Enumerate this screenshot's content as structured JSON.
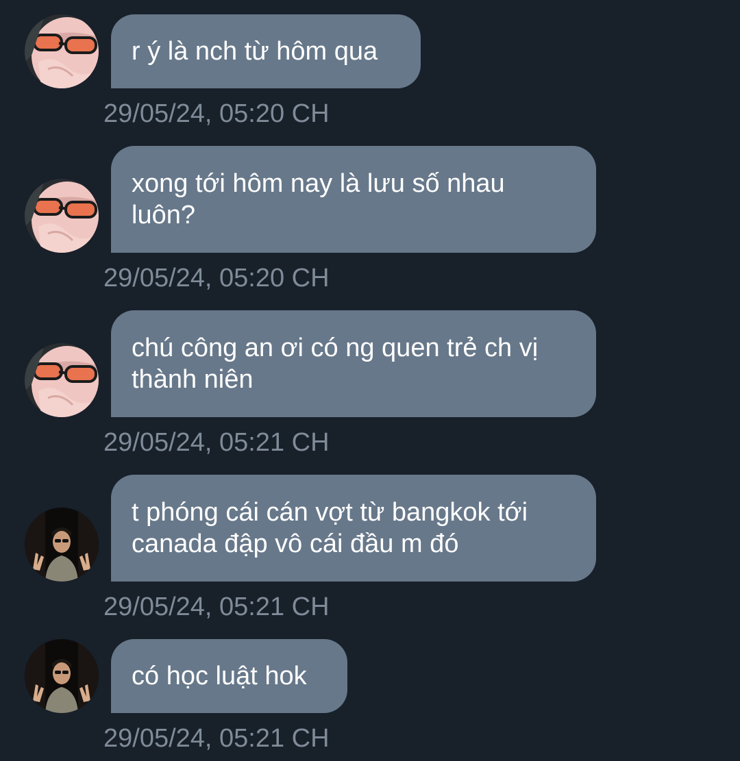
{
  "messages": [
    {
      "avatar": "sunglasses-avatar",
      "text": "r ý là nch từ hôm qua",
      "time": "29/05/24, 05:20 CH"
    },
    {
      "avatar": "sunglasses-avatar",
      "text": "xong tới hôm nay là lưu số nhau\nluôn?",
      "time": "29/05/24, 05:20 CH"
    },
    {
      "avatar": "sunglasses-avatar",
      "text": "chú công an ơi có ng quen trẻ ch vị\nthành niên",
      "time": "29/05/24, 05:21 CH"
    },
    {
      "avatar": "peace-sign-avatar",
      "text": "t phóng cái cán vợt từ bangkok tới\ncanada đập vô cái đầu m đó",
      "time": "29/05/24, 05:21 CH"
    },
    {
      "avatar": "peace-sign-avatar",
      "text": "có học luật hok",
      "time": "29/05/24, 05:21 CH"
    }
  ],
  "colors": {
    "background": "#18202a",
    "bubble": "#67788a",
    "timestamp": "#7f8b98"
  }
}
